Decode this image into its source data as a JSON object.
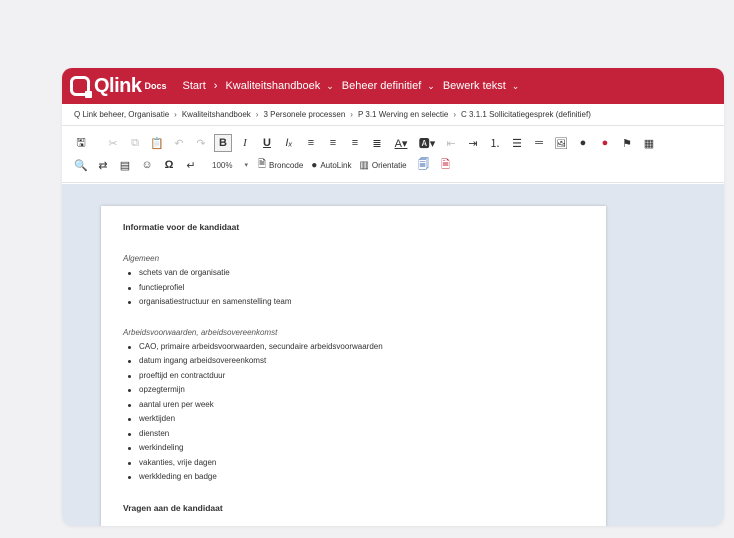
{
  "brand": {
    "name": "Qlink",
    "suffix": "Docs",
    "color": "#c4213a"
  },
  "nav": {
    "start": "Start",
    "kwaliteitshandboek": "Kwaliteitshandboek",
    "beheer": "Beheer definitief",
    "bewerk": "Bewerk tekst"
  },
  "breadcrumb": [
    "Q Link beheer, Organisatie",
    "Kwaliteitshandboek",
    "3 Personele processen",
    "P 3.1 Werving en selectie",
    "C 3.1.1 Sollicitatiegesprek (definitief)"
  ],
  "toolbar": {
    "zoom": "100%",
    "broncode": "Broncode",
    "autolink": "AutoLink",
    "orientatie": "Orientatie"
  },
  "document": {
    "heading1": "Informatie voor de kandidaat",
    "section1": {
      "title": "Algemeen",
      "items": [
        "schets van de organisatie",
        "functieprofiel",
        "organisatiestructuur en samenstelling team"
      ]
    },
    "section2": {
      "title": "Arbeidsvoorwaarden, arbeidsovereenkomst",
      "items": [
        "CAO, primaire arbeidsvoorwaarden, secundaire arbeidsvoorwaarden",
        "datum ingang arbeidsovereenkomst",
        "proeftijd en contractduur",
        "opzegtermijn",
        "aantal uren per week",
        "werktijden",
        "diensten",
        "werkindeling",
        "vakanties, vrije dagen",
        "werkkleding en badge"
      ]
    },
    "heading2": "Vragen aan de kandidaat"
  }
}
